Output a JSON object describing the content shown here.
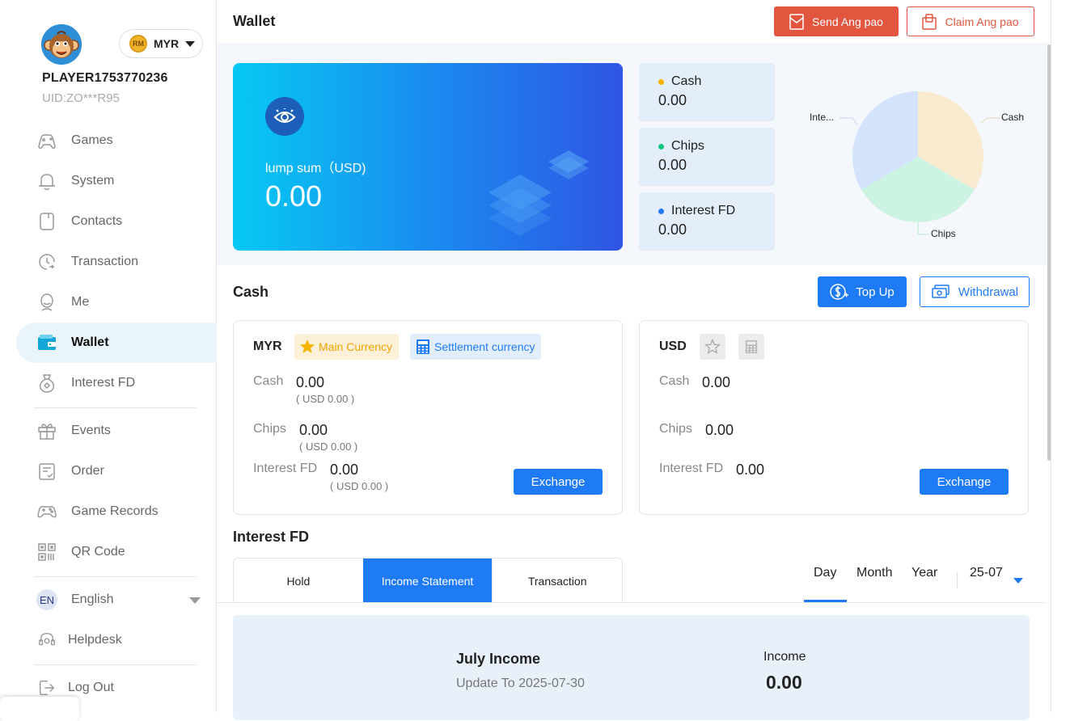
{
  "sidebar": {
    "currency_code": "MYR",
    "currency_coin": "RM",
    "player_name": "PLAYER1753770236",
    "player_uid": "UID:ZO***R95",
    "items": [
      {
        "label": "Games",
        "icon": "gamepad-icon"
      },
      {
        "label": "System",
        "icon": "bell-icon"
      },
      {
        "label": "Contacts",
        "icon": "contacts-icon"
      },
      {
        "label": "Transaction",
        "icon": "clock-icon"
      },
      {
        "label": "Me",
        "icon": "person-icon"
      },
      {
        "label": "Wallet",
        "icon": "wallet-icon",
        "active": true
      },
      {
        "label": "Interest FD",
        "icon": "money-bag-icon"
      },
      {
        "label": "Events",
        "icon": "gift-icon"
      },
      {
        "label": "Order",
        "icon": "order-icon"
      },
      {
        "label": "Game Records",
        "icon": "controller-icon"
      },
      {
        "label": "QR Code",
        "icon": "qr-code-icon"
      }
    ],
    "language_badge": "EN",
    "language": "English",
    "helpdesk": "Helpdesk",
    "logout": "Log Out"
  },
  "header": {
    "title": "Wallet",
    "send_label": "Send Ang pao",
    "claim_label": "Claim Ang pao"
  },
  "summary": {
    "lump_label": "lump sum（USD)",
    "lump_value": "0.00",
    "cards": [
      {
        "name": "Cash",
        "value": "0.00",
        "color": "#f5b400"
      },
      {
        "name": "Chips",
        "value": "0.00",
        "color": "#16c784"
      },
      {
        "name": "Interest FD",
        "value": "0.00",
        "color": "#1f7bf5"
      }
    ],
    "pie": {
      "labels": [
        "Cash",
        "Chips",
        "Inte..."
      ],
      "colors": [
        "#f8ebcf",
        "#cdf3e2",
        "#d3e3fb"
      ]
    }
  },
  "cash": {
    "title": "Cash",
    "topup_label": "Top Up",
    "withdraw_label": "Withdrawal",
    "myr": {
      "code": "MYR",
      "main_badge": "Main Currency",
      "settle_badge": "Settlement currency",
      "cash_label": "Cash",
      "cash_value": "0.00",
      "cash_sub": "( USD 0.00 )",
      "chips_label": "Chips",
      "chips_value": "0.00",
      "chips_sub": "( USD 0.00 )",
      "fd_label": "Interest FD",
      "fd_value": "0.00",
      "fd_sub": "( USD 0.00 )",
      "exchange_label": "Exchange"
    },
    "usd": {
      "code": "USD",
      "cash_label": "Cash",
      "cash_value": "0.00",
      "chips_label": "Chips",
      "chips_value": "0.00",
      "fd_label": "Interest FD",
      "fd_value": "0.00",
      "exchange_label": "Exchange"
    }
  },
  "interest": {
    "title": "Interest FD",
    "tabs": [
      "Hold",
      "Income Statement",
      "Transaction"
    ],
    "active_tab": "Income Statement",
    "periods": [
      "Day",
      "Month",
      "Year"
    ],
    "active_period": "Day",
    "date_value": "25-07",
    "income_title": "July Income",
    "income_update": "Update To 2025-07-30",
    "income_label": "Income",
    "income_value": "0.00"
  },
  "colors": {
    "accent": "#1f7bf5",
    "ang_pao": "#e2553f"
  }
}
